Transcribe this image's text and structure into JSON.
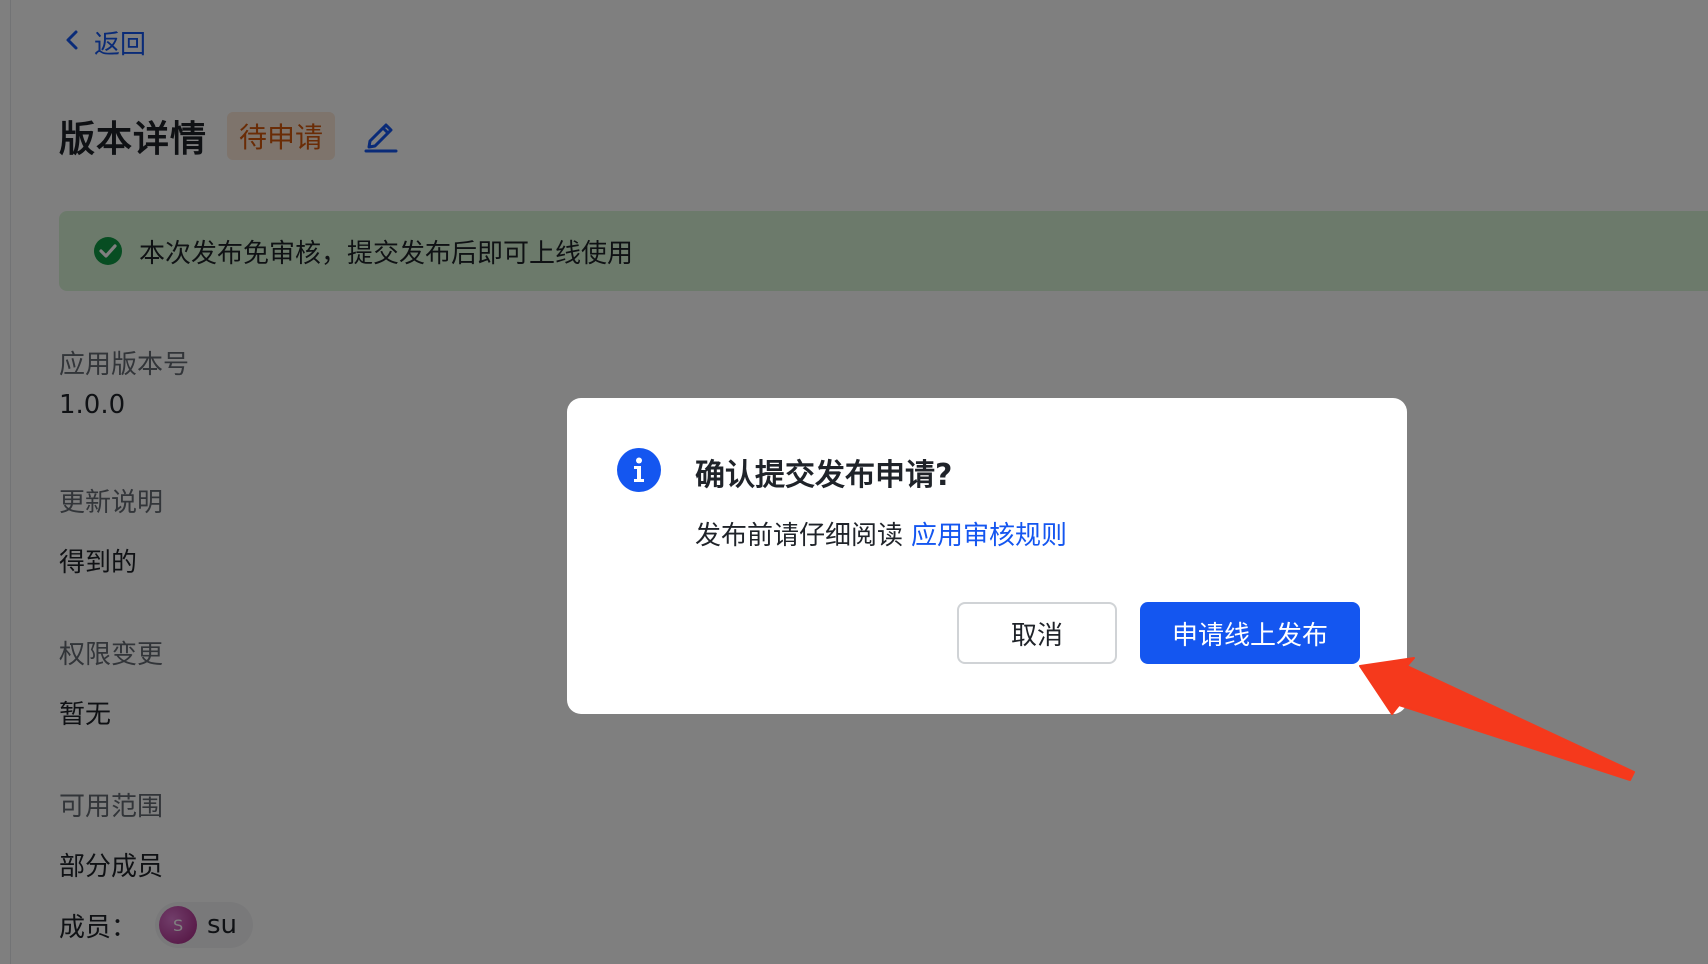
{
  "nav": {
    "back_label": "返回"
  },
  "header": {
    "title": "版本详情",
    "status": "待申请"
  },
  "notice": {
    "text": "本次发布免审核，提交发布后即可上线使用"
  },
  "fields": [
    {
      "label": "应用版本号",
      "value": "1.0.0"
    },
    {
      "label": "更新说明",
      "value": "得到的"
    },
    {
      "label": "权限变更",
      "value": "暂无"
    },
    {
      "label": "可用范围",
      "value": "部分成员"
    }
  ],
  "members": {
    "label": "成员：",
    "avatar_initial": "S",
    "name": "su"
  },
  "dialog": {
    "title": "确认提交发布申请?",
    "description": "发布前请仔细阅读",
    "link_text": "应用审核规则",
    "cancel_label": "取消",
    "confirm_label": "申请线上发布"
  },
  "colors": {
    "accent": "#1456f0",
    "status_tag_text": "#d4590d",
    "status_tag_bg": "#fde8d9",
    "notice_bg": "#d9f5d6",
    "success_icon": "#0f9a45",
    "annotation_arrow": "#f5391c"
  }
}
